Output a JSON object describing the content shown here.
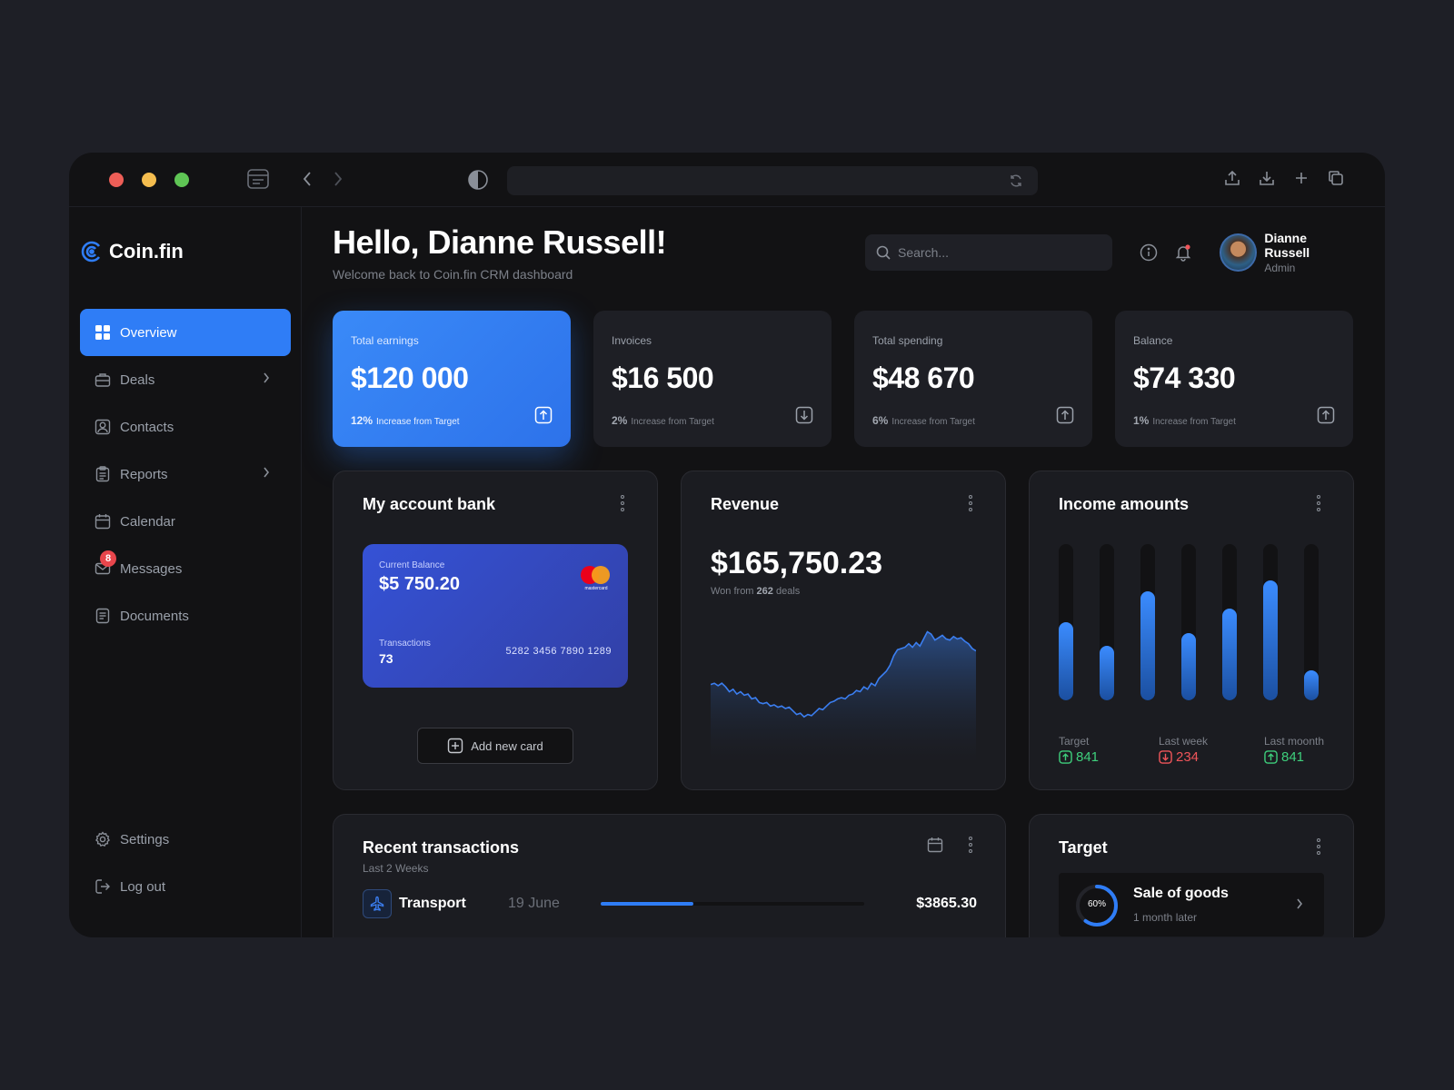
{
  "app": {
    "name": "Coin.fin"
  },
  "nav": {
    "items": [
      {
        "label": "Overview"
      },
      {
        "label": "Deals"
      },
      {
        "label": "Contacts"
      },
      {
        "label": "Reports"
      },
      {
        "label": "Calendar"
      },
      {
        "label": "Messages",
        "badge": "8"
      },
      {
        "label": "Documents"
      }
    ],
    "bottom": [
      {
        "label": "Settings"
      },
      {
        "label": "Log out"
      }
    ]
  },
  "header": {
    "greeting": "Hello, Dianne Russell!",
    "subtitle": "Welcome back to Coin.fin CRM dashboard",
    "search_placeholder": "Search...",
    "user": {
      "name": "Dianne Russell",
      "role": "Admin"
    }
  },
  "stats": [
    {
      "label": "Total earnings",
      "value": "$120 000",
      "pct": "12%",
      "note": "Increase from Target",
      "trend": "up"
    },
    {
      "label": "Invoices",
      "value": "$16 500",
      "pct": "2%",
      "note": "Increase from Target",
      "trend": "down"
    },
    {
      "label": "Total spending",
      "value": "$48 670",
      "pct": "6%",
      "note": "Increase from Target",
      "trend": "up"
    },
    {
      "label": "Balance",
      "value": "$74 330",
      "pct": "1%",
      "note": "Increase from Target",
      "trend": "up"
    }
  ],
  "bank": {
    "title": "My account bank",
    "card": {
      "balance_label": "Current Balance",
      "balance": "$5 750.20",
      "transactions_label": "Transactions",
      "transactions": "73",
      "number": "5282 3456 7890 1289",
      "brand": "mastercard"
    },
    "add_label": "Add new card"
  },
  "revenue": {
    "title": "Revenue",
    "value": "$165,750.23",
    "sub_prefix": "Won from",
    "deals": "262",
    "sub_suffix": "deals"
  },
  "chart_data": {
    "type": "area",
    "series": [
      {
        "values": [
          42,
          43,
          41,
          43,
          40,
          36,
          38,
          34,
          36,
          33,
          34,
          30,
          31,
          27,
          26,
          27,
          24,
          25,
          23,
          24,
          22,
          23,
          20,
          17,
          18,
          15,
          17,
          16,
          19,
          22,
          21,
          24,
          27,
          28,
          30,
          31,
          30,
          33,
          34,
          37,
          36,
          40,
          38,
          43,
          41,
          47,
          50,
          53,
          58,
          66,
          71,
          72,
          73,
          76,
          73,
          77,
          74,
          80,
          86,
          84,
          79,
          81,
          83,
          80,
          79,
          82,
          80,
          81,
          78,
          76,
          72,
          70
        ]
      }
    ],
    "title": "Revenue",
    "xlabel": "",
    "ylabel": ""
  },
  "income": {
    "title": "Income amounts",
    "bars": [
      0.5,
      0.35,
      0.7,
      0.43,
      0.59,
      0.77,
      0.19
    ],
    "stats": [
      {
        "label": "Target",
        "value": "841",
        "trend": "up"
      },
      {
        "label": "Last week",
        "value": "234",
        "trend": "down"
      },
      {
        "label": "Last moonth",
        "value": "841",
        "trend": "up"
      }
    ]
  },
  "transactions": {
    "title": "Recent transactions",
    "subtitle": "Last 2 Weeks",
    "rows": [
      {
        "name": "Transport",
        "date": "19 June",
        "amount": "$3865.30",
        "progress": 0.35
      }
    ]
  },
  "target": {
    "title": "Target",
    "item": {
      "name": "Sale of goods",
      "when": "1 month later",
      "percent": "60%",
      "fraction": 0.6
    }
  },
  "colors": {
    "accent": "#2f7df6",
    "bg": "#121214",
    "panel": "#1b1c21",
    "positive": "#3ecf7c",
    "negative": "#f0555a"
  }
}
